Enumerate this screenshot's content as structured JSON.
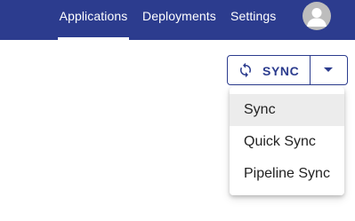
{
  "nav": {
    "items": [
      {
        "label": "Applications",
        "active": true
      },
      {
        "label": "Deployments",
        "active": false
      },
      {
        "label": "Settings",
        "active": false
      }
    ]
  },
  "user": {
    "avatar_icon": "account-avatar-icon"
  },
  "sync_control": {
    "button_label": "SYNC",
    "button_icon": "sync-icon",
    "toggle_icon": "caret-down-icon"
  },
  "menu": {
    "items": [
      {
        "label": "Sync",
        "selected": true
      },
      {
        "label": "Quick Sync",
        "selected": false
      },
      {
        "label": "Pipeline Sync",
        "selected": false
      }
    ]
  },
  "colors": {
    "topbar": "#2c3c8e",
    "accent": "#2c3c8e",
    "menu_selected_bg": "#ececec"
  }
}
